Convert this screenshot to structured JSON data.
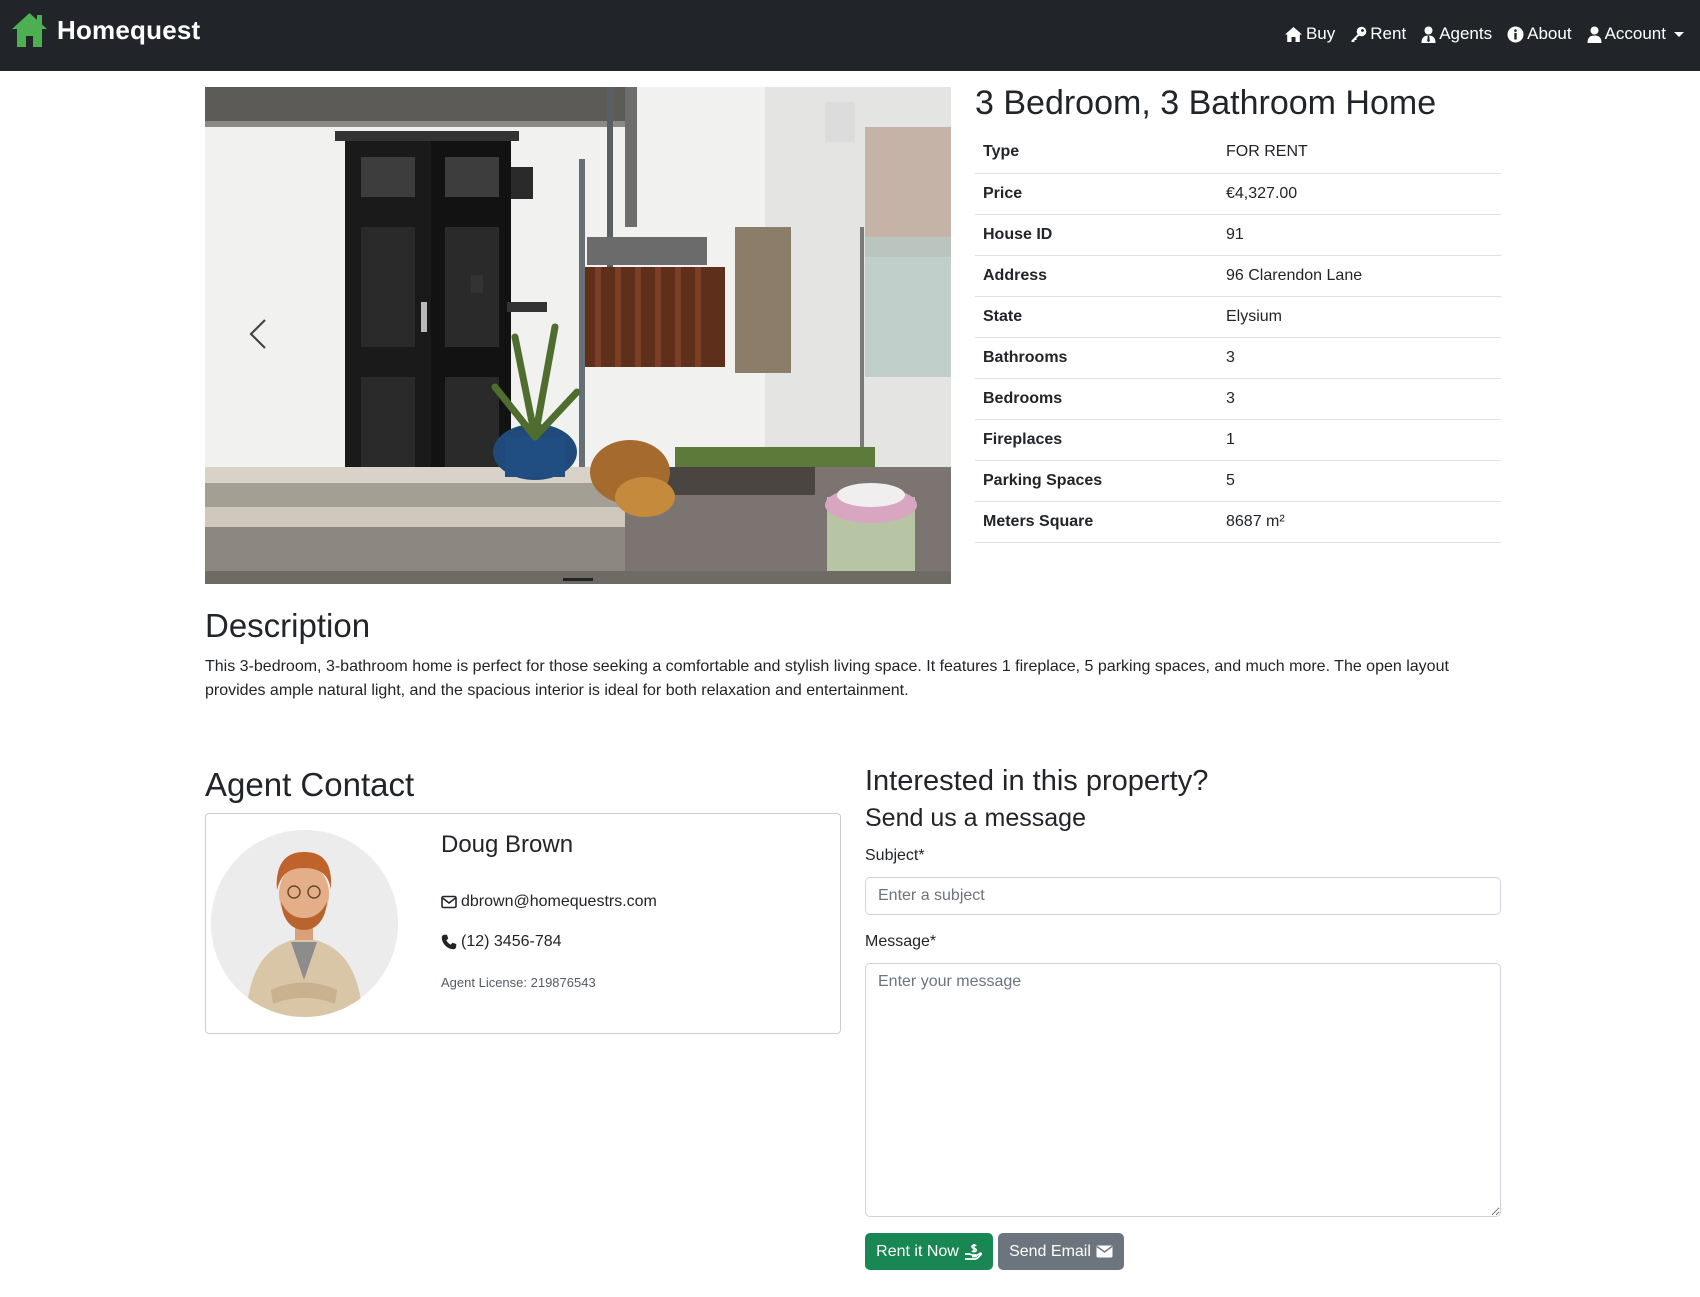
{
  "nav": {
    "brand": "Homequest",
    "links": [
      {
        "label": "Buy",
        "icon": "home-icon"
      },
      {
        "label": "Rent",
        "icon": "key-icon"
      },
      {
        "label": "Agents",
        "icon": "user-tie-icon"
      },
      {
        "label": "About",
        "icon": "info-circle-icon"
      },
      {
        "label": "Account",
        "icon": "user-icon"
      }
    ]
  },
  "colors": {
    "navbar": "#212529",
    "brand_logo": "#4caf50",
    "rent_button": "#198754",
    "email_button": "#6c757d"
  },
  "property": {
    "title": "3 Bedroom, 3 Bathroom Home",
    "details": [
      {
        "key": "Type",
        "value": "FOR RENT"
      },
      {
        "key": "Price",
        "value": "€4,327.00"
      },
      {
        "key": "House ID",
        "value": "91"
      },
      {
        "key": "Address",
        "value": "96 Clarendon Lane"
      },
      {
        "key": "State",
        "value": "Elysium"
      },
      {
        "key": "Bathrooms",
        "value": "3"
      },
      {
        "key": "Bedrooms",
        "value": "3"
      },
      {
        "key": "Fireplaces",
        "value": "1"
      },
      {
        "key": "Parking Spaces",
        "value": "5"
      },
      {
        "key": "Meters Square",
        "value": "8687 m²"
      }
    ]
  },
  "description": {
    "heading": "Description",
    "text": "This 3-bedroom, 3-bathroom home is perfect for those seeking a comfortable and stylish living space. It features 1 fireplace, 5 parking spaces, and much more. The open layout provides ample natural light, and the spacious interior is ideal for both relaxation and entertainment."
  },
  "agent": {
    "heading": "Agent Contact",
    "name": "Doug Brown",
    "email": "dbrown@homequestrs.com",
    "phone": "(12) 3456-784",
    "license": "Agent License: 219876543"
  },
  "contact_form": {
    "heading": "Interested in this property?",
    "subheading": "Send us a message",
    "subject_label": "Subject*",
    "subject_placeholder": "Enter a subject",
    "message_label": "Message*",
    "message_placeholder": "Enter your message",
    "rent_button": "Rent it Now",
    "email_button": "Send Email"
  }
}
